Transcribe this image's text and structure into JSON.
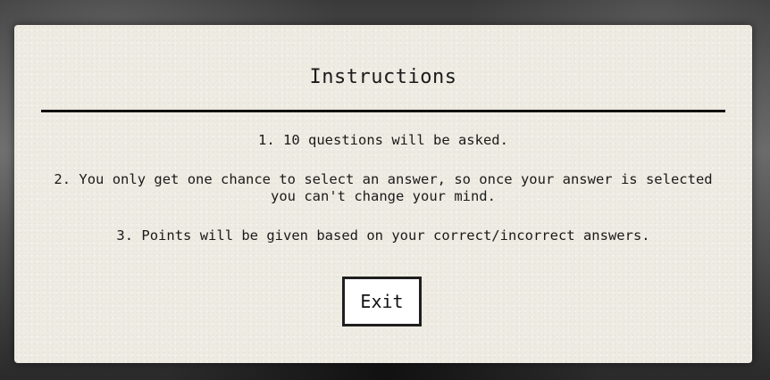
{
  "modal": {
    "title": "Instructions",
    "instructions": [
      "1. 10 questions will be asked.",
      "2. You only get one chance to select an answer, so once your answer is selected you can't change your mind.",
      "3. Points will be given based on your correct/incorrect answers."
    ],
    "exit_label": "Exit"
  },
  "colors": {
    "panel_bg": "#eeebe2",
    "text": "#1a1a1a",
    "divider": "#111111",
    "button_border": "#1f1f1f"
  }
}
